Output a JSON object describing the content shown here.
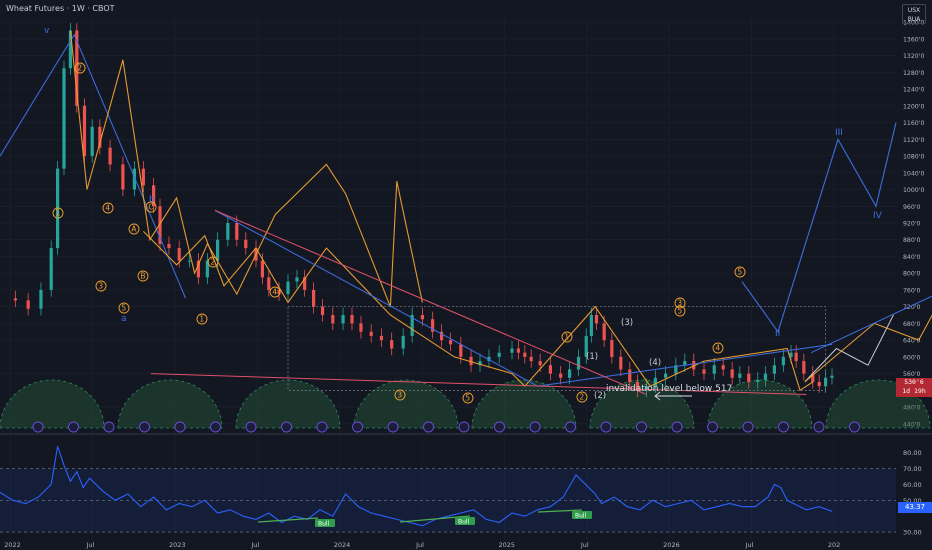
{
  "header": {
    "title": "Wheat Futures · 1W · CBOT",
    "currency": "USX",
    "unit": "BUA"
  },
  "price_tag": {
    "value": "530'6",
    "countdown": "1d 19h"
  },
  "rsi_tag": {
    "value": "43.37"
  },
  "colors": {
    "bg": "#131722",
    "up": "#26a69a",
    "down": "#ef5350",
    "blue": "#3d6fe0",
    "orange": "#f0a030",
    "pink": "#e0506a",
    "white": "#c8ccd4",
    "grid": "#1e2230"
  },
  "chart_data": [
    {
      "type": "line",
      "title": "Wheat Futures · 1W · CBOT",
      "y_axis_ticks": [
        "1400'0",
        "1360'0",
        "1320'0",
        "1280'0",
        "1240'0",
        "1200'0",
        "1160'0",
        "1120'0",
        "1080'0",
        "1040'0",
        "1000'0",
        "960'0",
        "920'0",
        "880'0",
        "840'0",
        "800'0",
        "760'0",
        "720'0",
        "680'0",
        "640'0",
        "600'0",
        "560'0",
        "480'0",
        "440'0"
      ],
      "x_axis_ticks": [
        "2022",
        "Jul",
        "2023",
        "Jul",
        "2024",
        "Jul",
        "2025",
        "Jul",
        "2026",
        "Jul",
        "202"
      ],
      "ylim": [
        430,
        1410
      ],
      "candles_path": [
        [
          0,
          740
        ],
        [
          0.12,
          735
        ],
        [
          0.22,
          715
        ],
        [
          0.32,
          760
        ],
        [
          0.4,
          860
        ],
        [
          0.45,
          1050
        ],
        [
          0.5,
          1290
        ],
        [
          0.55,
          1380
        ],
        [
          0.6,
          1200
        ],
        [
          0.66,
          1080
        ],
        [
          0.72,
          1150
        ],
        [
          0.78,
          1100
        ],
        [
          0.86,
          1060
        ],
        [
          0.96,
          1000
        ],
        [
          1.05,
          1050
        ],
        [
          1.12,
          1010
        ],
        [
          1.2,
          960
        ],
        [
          1.25,
          870
        ],
        [
          1.32,
          860
        ],
        [
          1.4,
          830
        ],
        [
          1.48,
          830
        ],
        [
          1.55,
          790
        ],
        [
          1.62,
          830
        ],
        [
          1.7,
          880
        ],
        [
          1.78,
          920
        ],
        [
          1.85,
          880
        ],
        [
          1.92,
          860
        ],
        [
          2.0,
          830
        ],
        [
          2.05,
          790
        ],
        [
          2.1,
          760
        ],
        [
          2.18,
          750
        ],
        [
          2.25,
          780
        ],
        [
          2.32,
          790
        ],
        [
          2.38,
          760
        ],
        [
          2.45,
          720
        ],
        [
          2.52,
          700
        ],
        [
          2.6,
          680
        ],
        [
          2.68,
          700
        ],
        [
          2.75,
          680
        ],
        [
          2.82,
          660
        ],
        [
          2.9,
          650
        ],
        [
          2.98,
          640
        ],
        [
          3.06,
          620
        ],
        [
          3.15,
          650
        ],
        [
          3.22,
          700
        ],
        [
          3.3,
          690
        ],
        [
          3.38,
          660
        ],
        [
          3.45,
          640
        ],
        [
          3.52,
          630
        ],
        [
          3.6,
          600
        ],
        [
          3.68,
          580
        ],
        [
          3.75,
          590
        ],
        [
          3.82,
          600
        ],
        [
          3.9,
          610
        ],
        [
          4.0,
          620
        ],
        [
          4.05,
          610
        ],
        [
          4.1,
          600
        ],
        [
          4.15,
          590
        ],
        [
          4.22,
          580
        ],
        [
          4.3,
          560
        ],
        [
          4.38,
          550
        ],
        [
          4.45,
          570
        ],
        [
          4.52,
          600
        ],
        [
          4.58,
          650
        ],
        [
          4.62,
          700
        ],
        [
          4.66,
          680
        ],
        [
          4.72,
          640
        ],
        [
          4.78,
          600
        ],
        [
          4.85,
          570
        ],
        [
          4.92,
          540
        ],
        [
          4.98,
          520
        ],
        [
          5.05,
          530
        ],
        [
          5.12,
          550
        ],
        [
          5.2,
          560
        ],
        [
          5.28,
          580
        ],
        [
          5.35,
          590
        ],
        [
          5.42,
          570
        ],
        [
          5.5,
          560
        ],
        [
          5.58,
          580
        ],
        [
          5.65,
          570
        ],
        [
          5.72,
          550
        ],
        [
          5.78,
          560
        ],
        [
          5.85,
          540
        ],
        [
          5.92,
          545
        ],
        [
          5.98,
          560
        ],
        [
          6.05,
          580
        ],
        [
          6.12,
          600
        ],
        [
          6.18,
          610
        ],
        [
          6.22,
          590
        ],
        [
          6.28,
          560
        ],
        [
          6.35,
          540
        ],
        [
          6.4,
          530
        ],
        [
          6.45,
          550
        ],
        [
          6.5,
          555
        ]
      ],
      "series": [
        {
          "values": [
            [
              0,
              1080
            ],
            [
              0.58,
              1370
            ],
            [
              1.45,
              740
            ]
          ]
        },
        {
          "values": [
            [
              0.55,
              1380
            ],
            [
              0.68,
              1000
            ],
            [
              0.96,
              1310
            ],
            [
              1.17,
              880
            ],
            [
              1.38,
              980
            ],
            [
              1.52,
              800
            ],
            [
              1.62,
              870
            ],
            [
              1.85,
              750
            ],
            [
              2.15,
              940
            ],
            [
              2.55,
              1060
            ],
            [
              2.7,
              990
            ],
            [
              3.05,
              720
            ],
            [
              3.1,
              1020
            ],
            [
              3.3,
              730
            ]
          ]
        },
        {
          "values": [
            [
              1.12,
              900
            ],
            [
              1.38,
              820
            ],
            [
              1.6,
              890
            ],
            [
              1.75,
              770
            ],
            [
              2.0,
              860
            ],
            [
              2.25,
              730
            ],
            [
              2.55,
              860
            ],
            [
              3.05,
              700
            ],
            [
              3.55,
              600
            ],
            [
              4.0,
              560
            ],
            [
              4.1,
              530
            ],
            [
              4.65,
              720
            ],
            [
              5.08,
              530
            ],
            [
              5.5,
              590
            ],
            [
              6.15,
              620
            ],
            [
              6.25,
              520
            ],
            [
              6.35,
              540
            ]
          ]
        },
        {
          "values": [
            [
              1.68,
              950
            ],
            [
              4.2,
              530
            ],
            [
              6.5,
              630
            ]
          ]
        },
        {
          "values": [
            [
              1.68,
              950
            ],
            [
              5.05,
              510
            ]
          ]
        }
      ]
    },
    {
      "type": "line",
      "ylabel": "",
      "y_axis_ticks": [
        "80.00",
        "70.00",
        "60.00",
        "50.00",
        "30.00"
      ],
      "ylim": [
        25,
        88
      ],
      "x": [
        0,
        0.1,
        0.2,
        0.3,
        0.4,
        0.45,
        0.5,
        0.55,
        0.6,
        0.65,
        0.7,
        0.8,
        0.9,
        1.0,
        1.1,
        1.2,
        1.3,
        1.4,
        1.5,
        1.6,
        1.7,
        1.8,
        1.9,
        2.0,
        2.1,
        2.2,
        2.3,
        2.4,
        2.5,
        2.6,
        2.7,
        2.8,
        2.9,
        3.0,
        3.1,
        3.2,
        3.3,
        3.4,
        3.5,
        3.6,
        3.7,
        3.8,
        3.9,
        4.0,
        4.1,
        4.2,
        4.3,
        4.4,
        4.5,
        4.55,
        4.6,
        4.65,
        4.7,
        4.8,
        4.9,
        5.0,
        5.1,
        5.2,
        5.3,
        5.4,
        5.5,
        5.6,
        5.7,
        5.8,
        5.9,
        6.0,
        6.05,
        6.1,
        6.15,
        6.2,
        6.3,
        6.4,
        6.5
      ],
      "series": [
        {
          "name": "RSI",
          "values": [
            55,
            50,
            48,
            52,
            60,
            84,
            72,
            62,
            68,
            58,
            64,
            56,
            50,
            54,
            46,
            52,
            44,
            48,
            46,
            50,
            42,
            44,
            40,
            38,
            42,
            36,
            40,
            38,
            44,
            40,
            54,
            46,
            42,
            40,
            38,
            36,
            34,
            38,
            40,
            42,
            44,
            38,
            36,
            42,
            40,
            44,
            46,
            52,
            66,
            62,
            58,
            54,
            48,
            52,
            46,
            44,
            50,
            46,
            48,
            50,
            44,
            46,
            48,
            46,
            46,
            52,
            60,
            58,
            50,
            48,
            44,
            46,
            43
          ]
        }
      ]
    }
  ],
  "wave_labels": [
    "v",
    "2",
    "1",
    "4",
    "3",
    "5",
    "a",
    "b",
    "C",
    "A",
    "B",
    "2",
    "1",
    "4",
    "3",
    "5",
    "1",
    "2",
    "(1)",
    "(2)",
    "(3)",
    "(4)",
    "3",
    "5",
    "4",
    "5",
    "III",
    "IV",
    "II"
  ],
  "annotations": [
    "invalidation level below 517",
    "Bull",
    "Bull",
    "Bull"
  ]
}
